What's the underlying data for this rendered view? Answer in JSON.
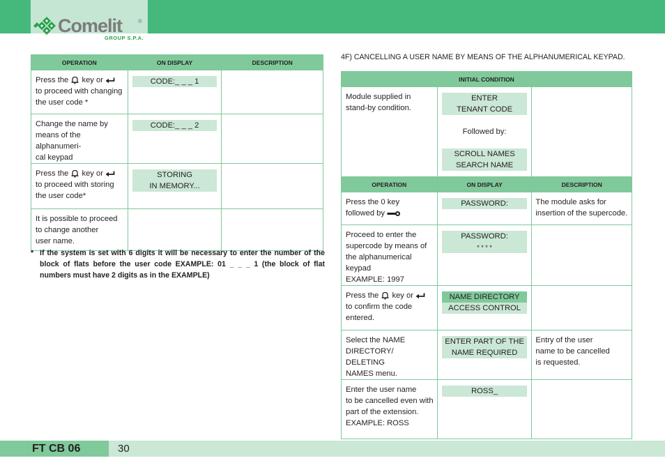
{
  "brand": {
    "name": "Comelit",
    "registered": "®",
    "group": "GROUP S.P.A.",
    "colors": {
      "header_green": "#45b97c",
      "table_header": "#80c99b",
      "screen_bg": "#cbe7d6",
      "logo_green": "#2aa14e"
    }
  },
  "left_table": {
    "headers": [
      "OPERATION",
      "ON DISPLAY",
      "DESCRIPTION"
    ],
    "rows": [
      {
        "op_lines": [
          "Press the",
          "key or",
          "to proceed with changing",
          "the user code *"
        ],
        "icons": [
          "bell-icon",
          "enter-icon"
        ],
        "display": [
          "CODE:_ _ _ 1"
        ],
        "desc": []
      },
      {
        "op_lines": [
          "Change the name by",
          "means of the alphanumeri-",
          "cal keypad"
        ],
        "display": [
          "CODE:_ _ _ 2"
        ],
        "desc": []
      },
      {
        "op_lines": [
          "Press the",
          "key or",
          "to proceed with storing",
          "the user code*"
        ],
        "icons": [
          "bell-icon",
          "enter-icon"
        ],
        "display": [
          "STORING",
          "IN MEMORY..."
        ],
        "desc": []
      },
      {
        "op_lines": [
          "It is possible to proceed",
          "to change another",
          "user name."
        ],
        "display": [],
        "desc": []
      }
    ]
  },
  "footnote": {
    "marker": "*",
    "text": "If the system is set with 6 digits it will be necessary to enter the number of the block of flats before the user code EXAMPLE: 01 _ _ _ 1 (the block of flat numbers must have 2 digits as in the EXAMPLE)"
  },
  "right_section": {
    "title": "4F) CANCELLING A USER NAME BY MEANS OF THE ALPHANUMERICAL KEYPAD.",
    "initial_condition": {
      "header": "INITIAL CONDITION",
      "op_lines": [
        "Module supplied in",
        "stand-by condition."
      ],
      "display_1": [
        "ENTER",
        "TENANT CODE"
      ],
      "followed_by": "Followed by:",
      "display_2": [
        "SCROLL NAMES",
        "SEARCH NAME"
      ]
    },
    "headers": [
      "OPERATION",
      "ON DISPLAY",
      "DESCRIPTION"
    ],
    "rows": [
      {
        "op_lines": [
          "Press the 0 key",
          "followed by"
        ],
        "icons": [
          "key-icon"
        ],
        "display": [
          "PASSWORD:"
        ],
        "desc": [
          "The module asks for",
          "insertion of the supercode."
        ]
      },
      {
        "op_lines": [
          "Proceed to enter the",
          "supercode by means of",
          "the alphanumerical keypad",
          "EXAMPLE: 1997"
        ],
        "display": [
          "PASSWORD:",
          "* * * *"
        ],
        "desc": []
      },
      {
        "op_lines": [
          "Press the",
          "key or",
          "to confirm the code",
          "entered."
        ],
        "icons": [
          "bell-icon",
          "enter-icon"
        ],
        "display": [
          "NAME DIRECTORY",
          "ACCESS CONTROL"
        ],
        "display_highlighted": "NAME DIRECTORY",
        "desc": []
      },
      {
        "op_lines": [
          "Select the NAME",
          "DIRECTORY/ DELETING",
          "NAMES menu."
        ],
        "display": [
          "ENTER PART OF THE",
          "NAME REQUIRED"
        ],
        "desc": [
          "Entry of the user",
          "name to be cancelled",
          "is requested."
        ]
      },
      {
        "op_lines": [
          "Enter the user name",
          "to be cancelled even with",
          "part of the extension.",
          "EXAMPLE: ROSS"
        ],
        "display": [
          "ROSS_"
        ],
        "desc": []
      }
    ]
  },
  "footer": {
    "doc_code": "FT CB 06",
    "page_number": "30"
  }
}
